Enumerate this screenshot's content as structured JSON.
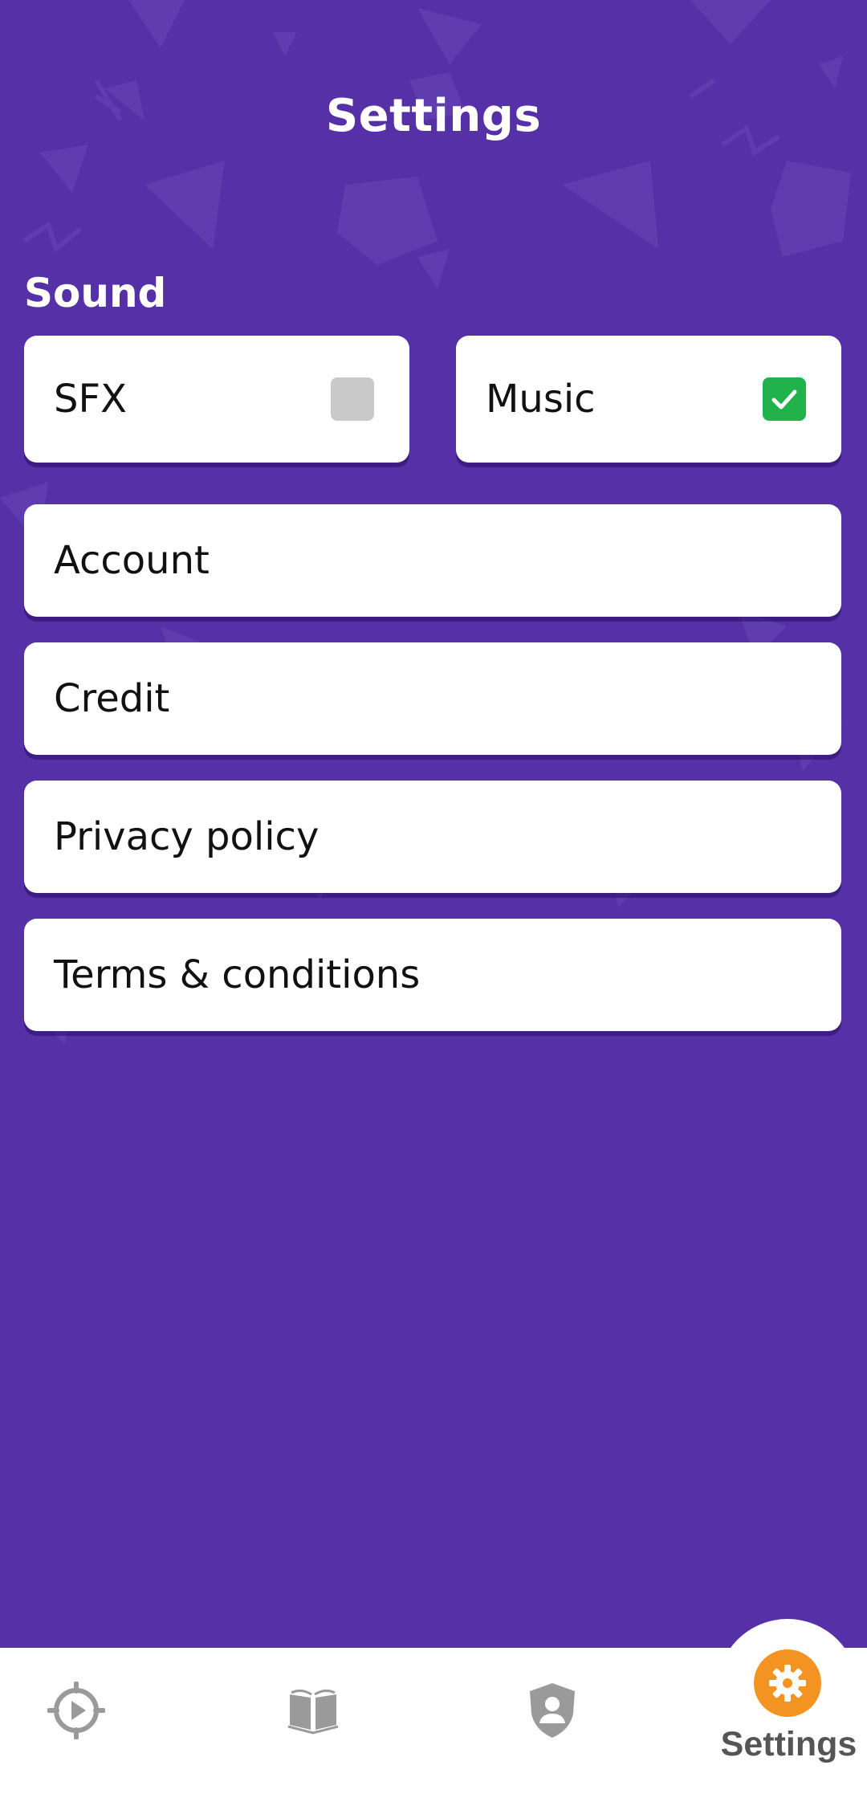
{
  "header": {
    "title": "Settings"
  },
  "sound": {
    "section_label": "Sound",
    "sfx": {
      "label": "SFX",
      "checked": false
    },
    "music": {
      "label": "Music",
      "checked": true
    }
  },
  "menu": {
    "items": [
      {
        "label": "Account"
      },
      {
        "label": "Credit"
      },
      {
        "label": "Privacy policy"
      },
      {
        "label": "Terms & conditions"
      }
    ]
  },
  "bottom_nav": {
    "items": [
      {
        "icon": "play-target-icon",
        "label": ""
      },
      {
        "icon": "book-icon",
        "label": ""
      },
      {
        "icon": "user-shield-icon",
        "label": ""
      },
      {
        "icon": "gear-icon",
        "label": "Settings",
        "active": true
      }
    ]
  },
  "colors": {
    "background": "#5530A6",
    "card": "#FFFFFF",
    "checkbox_on": "#22B24C",
    "checkbox_off": "#C9C9C9",
    "active_tab_icon": "#F39322",
    "inactive_tab_icon": "#9A9A9A"
  }
}
